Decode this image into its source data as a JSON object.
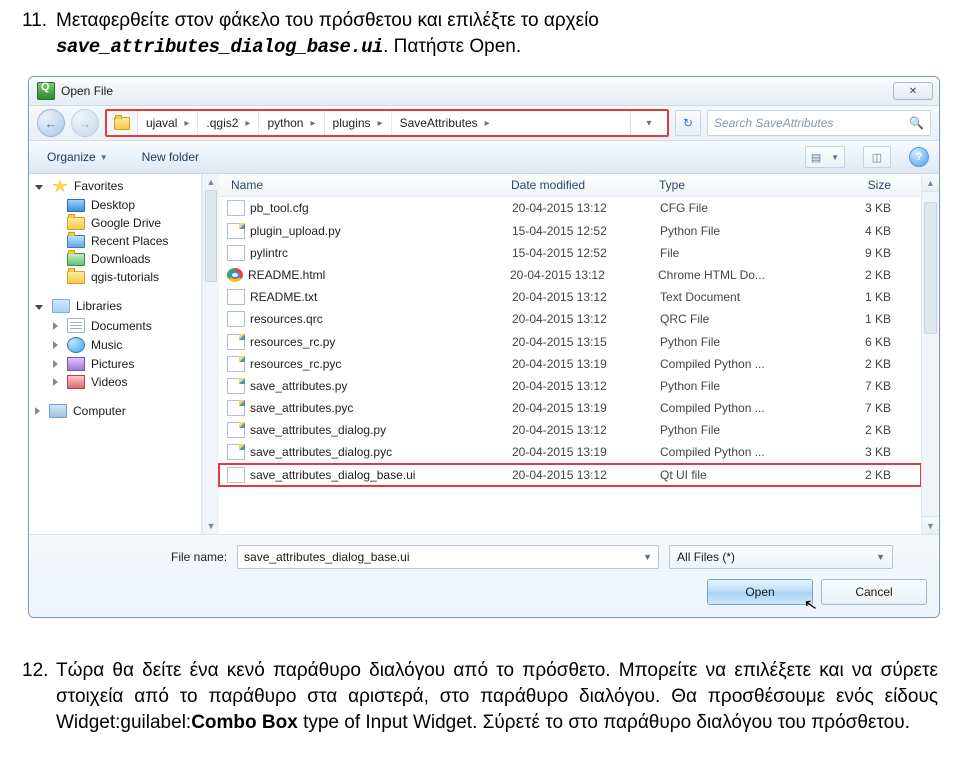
{
  "instruction_11": {
    "num": "11.",
    "text_a": "Μεταφερθείτε στον φάκελο του πρόσθετου και επιλέξτε το αρχείο ",
    "code": "save_attributes_dialog_base.ui",
    "text_b": ". Πατήστε Open."
  },
  "instruction_12": {
    "num": "12.",
    "text_a": "Τώρα θα δείτε ένα κενό παράθυρο διαλόγου από το πρόσθετο. Μπορείτε να επιλέξετε και να σύρετε στοιχεία από το παράθυρο στα αριστερά, στο παράθυρο διαλόγου. Θα προσθέσουμε ενός είδους Widget:guilabel:",
    "bold": "Combo Box",
    "text_b": " type of Input Widget. Σύρετέ το στο παράθυρο διαλόγου του πρόσθετου."
  },
  "dialog": {
    "title": "Open File",
    "close_glyph": "✕",
    "breadcrumb": [
      "ujaval",
      ".qgis2",
      "python",
      "plugins",
      "SaveAttributes"
    ],
    "search_placeholder": "Search SaveAttributes",
    "toolbar": {
      "organize": "Organize",
      "newfolder": "New folder"
    },
    "sidebar": {
      "favorites": "Favorites",
      "fav_items": [
        "Desktop",
        "Google Drive",
        "Recent Places",
        "Downloads",
        "qgis-tutorials"
      ],
      "libraries": "Libraries",
      "lib_items": [
        "Documents",
        "Music",
        "Pictures",
        "Videos"
      ],
      "computer": "Computer"
    },
    "columns": {
      "name": "Name",
      "date": "Date modified",
      "type": "Type",
      "size": "Size"
    },
    "rows": [
      {
        "icon": "generic",
        "name": "pb_tool.cfg",
        "date": "20-04-2015 13:12",
        "type": "CFG File",
        "size": "3 KB"
      },
      {
        "icon": "py",
        "name": "plugin_upload.py",
        "date": "15-04-2015 12:52",
        "type": "Python File",
        "size": "4 KB"
      },
      {
        "icon": "generic",
        "name": "pylintrc",
        "date": "15-04-2015 12:52",
        "type": "File",
        "size": "9 KB"
      },
      {
        "icon": "chrome",
        "name": "README.html",
        "date": "20-04-2015 13:12",
        "type": "Chrome HTML Do...",
        "size": "2 KB"
      },
      {
        "icon": "txt",
        "name": "README.txt",
        "date": "20-04-2015 13:12",
        "type": "Text Document",
        "size": "1 KB"
      },
      {
        "icon": "generic",
        "name": "resources.qrc",
        "date": "20-04-2015 13:12",
        "type": "QRC File",
        "size": "1 KB"
      },
      {
        "icon": "py",
        "name": "resources_rc.py",
        "date": "20-04-2015 13:15",
        "type": "Python File",
        "size": "6 KB"
      },
      {
        "icon": "py",
        "name": "resources_rc.pyc",
        "date": "20-04-2015 13:19",
        "type": "Compiled Python ...",
        "size": "2 KB"
      },
      {
        "icon": "py",
        "name": "save_attributes.py",
        "date": "20-04-2015 13:12",
        "type": "Python File",
        "size": "7 KB"
      },
      {
        "icon": "py",
        "name": "save_attributes.pyc",
        "date": "20-04-2015 13:19",
        "type": "Compiled Python ...",
        "size": "7 KB"
      },
      {
        "icon": "py",
        "name": "save_attributes_dialog.py",
        "date": "20-04-2015 13:12",
        "type": "Python File",
        "size": "2 KB"
      },
      {
        "icon": "py",
        "name": "save_attributes_dialog.pyc",
        "date": "20-04-2015 13:19",
        "type": "Compiled Python ...",
        "size": "3 KB"
      },
      {
        "icon": "ui",
        "name": "save_attributes_dialog_base.ui",
        "date": "20-04-2015 13:12",
        "type": "Qt UI file",
        "size": "2 KB",
        "highlight": true
      }
    ],
    "filename_label": "File name:",
    "filename_value": "save_attributes_dialog_base.ui",
    "filter": "All Files (*)",
    "open": "Open",
    "cancel": "Cancel"
  }
}
